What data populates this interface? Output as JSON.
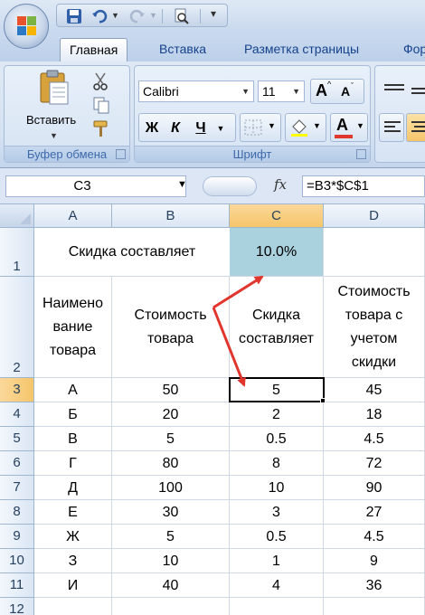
{
  "qat": {
    "title": ""
  },
  "tabs": [
    {
      "label": "Главная",
      "active": true
    },
    {
      "label": "Вставка",
      "active": false
    },
    {
      "label": "Разметка страницы",
      "active": false
    },
    {
      "label": "Фор",
      "active": false
    }
  ],
  "ribbon": {
    "clipboard": {
      "label": "Буфер обмена",
      "paste_label": "Вставить"
    },
    "font": {
      "label": "Шрифт",
      "font_name": "Calibri",
      "font_size": "11",
      "bold": "Ж",
      "italic": "К",
      "underline": "Ч",
      "grow": "A",
      "shrink": "A",
      "font_color_glyph": "A"
    }
  },
  "formula_bar": {
    "name_box": "C3",
    "fx": "fx",
    "formula": "=B3*$C$1"
  },
  "grid": {
    "columns": [
      "A",
      "B",
      "C",
      "D"
    ],
    "selected_column": "C",
    "rows": [
      "1",
      "2",
      "3",
      "4",
      "5",
      "6",
      "7",
      "8",
      "9",
      "10",
      "11",
      "12"
    ],
    "selected_row": "3",
    "row1": {
      "a": "Скидка составляет",
      "c": "10.0%"
    },
    "headers": {
      "a": [
        "Наимено",
        "вание",
        "товара"
      ],
      "b": [
        "Стоимость",
        "товара"
      ],
      "c": [
        "Скидка",
        "составляет"
      ],
      "d": [
        "Стоимость",
        "товара с",
        "учетом",
        "скидки"
      ]
    },
    "data": [
      {
        "name": "А",
        "price": "50",
        "discount": "5",
        "total": "45"
      },
      {
        "name": "Б",
        "price": "20",
        "discount": "2",
        "total": "18"
      },
      {
        "name": "В",
        "price": "5",
        "discount": "0.5",
        "total": "4.5"
      },
      {
        "name": "Г",
        "price": "80",
        "discount": "8",
        "total": "72"
      },
      {
        "name": "Д",
        "price": "100",
        "discount": "10",
        "total": "90"
      },
      {
        "name": "Е",
        "price": "30",
        "discount": "3",
        "total": "27"
      },
      {
        "name": "Ж",
        "price": "5",
        "discount": "0.5",
        "total": "4.5"
      },
      {
        "name": "З",
        "price": "10",
        "discount": "1",
        "total": "9"
      },
      {
        "name": "И",
        "price": "40",
        "discount": "4",
        "total": "36"
      }
    ]
  },
  "colors": {
    "teal_cell": "#a9d1de",
    "arrow": "#e0362d",
    "selection": "#f5c56a"
  }
}
